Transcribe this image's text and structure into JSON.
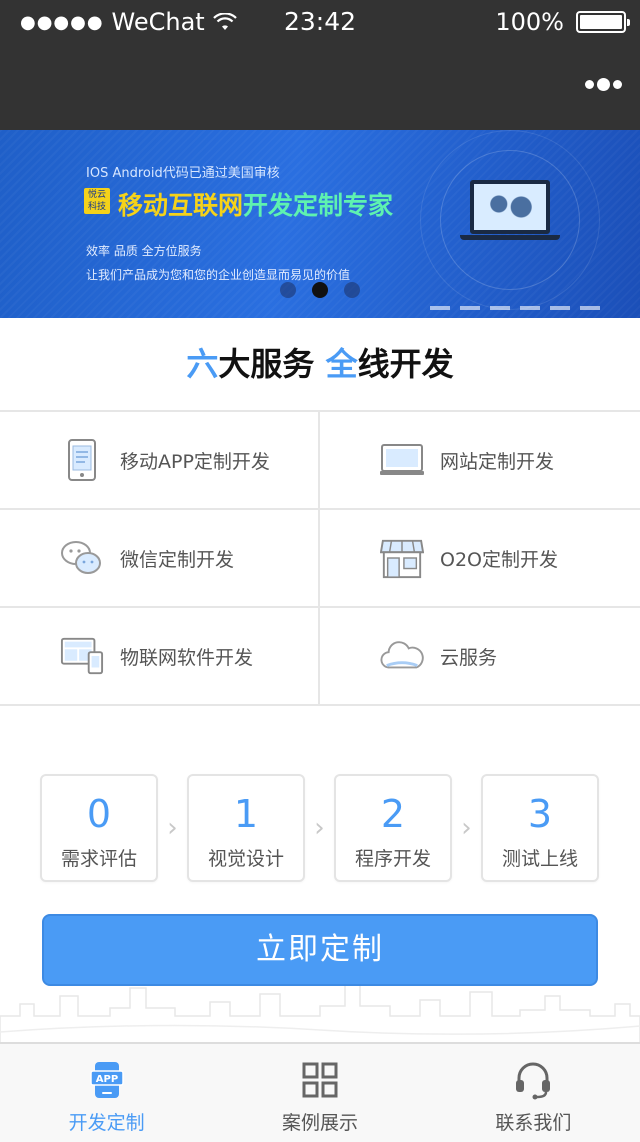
{
  "status_bar": {
    "signal": "●●●●●",
    "carrier": "WeChat",
    "time": "23:42",
    "battery": "100%"
  },
  "banner": {
    "line1": "IOS Android代码已通过美国审核",
    "logo_text": "悦云科技",
    "headline_part1": "移动互联网",
    "headline_part2": "开发定制专家",
    "line3": "效率 品质 全方位服务",
    "line4": "让我们产品成为您和您的企业创造显而易见的价值",
    "pages": 3,
    "active_page": 1
  },
  "services": {
    "title_a_accent": "六",
    "title_a": "大服务 ",
    "title_b_accent": "全",
    "title_b": "线开发",
    "items": [
      {
        "label": "移动APP定制开发",
        "icon": "phone-icon"
      },
      {
        "label": "网站定制开发",
        "icon": "monitor-icon"
      },
      {
        "label": "微信定制开发",
        "icon": "wechat-icon"
      },
      {
        "label": "O2O定制开发",
        "icon": "storefront-icon"
      },
      {
        "label": "物联网软件开发",
        "icon": "devices-icon"
      },
      {
        "label": "云服务",
        "icon": "cloud-icon"
      }
    ]
  },
  "steps": [
    {
      "num": "0",
      "label": "需求评估"
    },
    {
      "num": "1",
      "label": "视觉设计"
    },
    {
      "num": "2",
      "label": "程序开发"
    },
    {
      "num": "3",
      "label": "测试上线"
    }
  ],
  "cta_label": "立即定制",
  "tabs": [
    {
      "label": "开发定制",
      "icon": "app-icon",
      "active": true
    },
    {
      "label": "案例展示",
      "icon": "grid-icon",
      "active": false
    },
    {
      "label": "联系我们",
      "icon": "headset-icon",
      "active": false
    }
  ],
  "colors": {
    "accent": "#4a9bf5",
    "header": "#333333",
    "banner": "#2a6fe0"
  }
}
